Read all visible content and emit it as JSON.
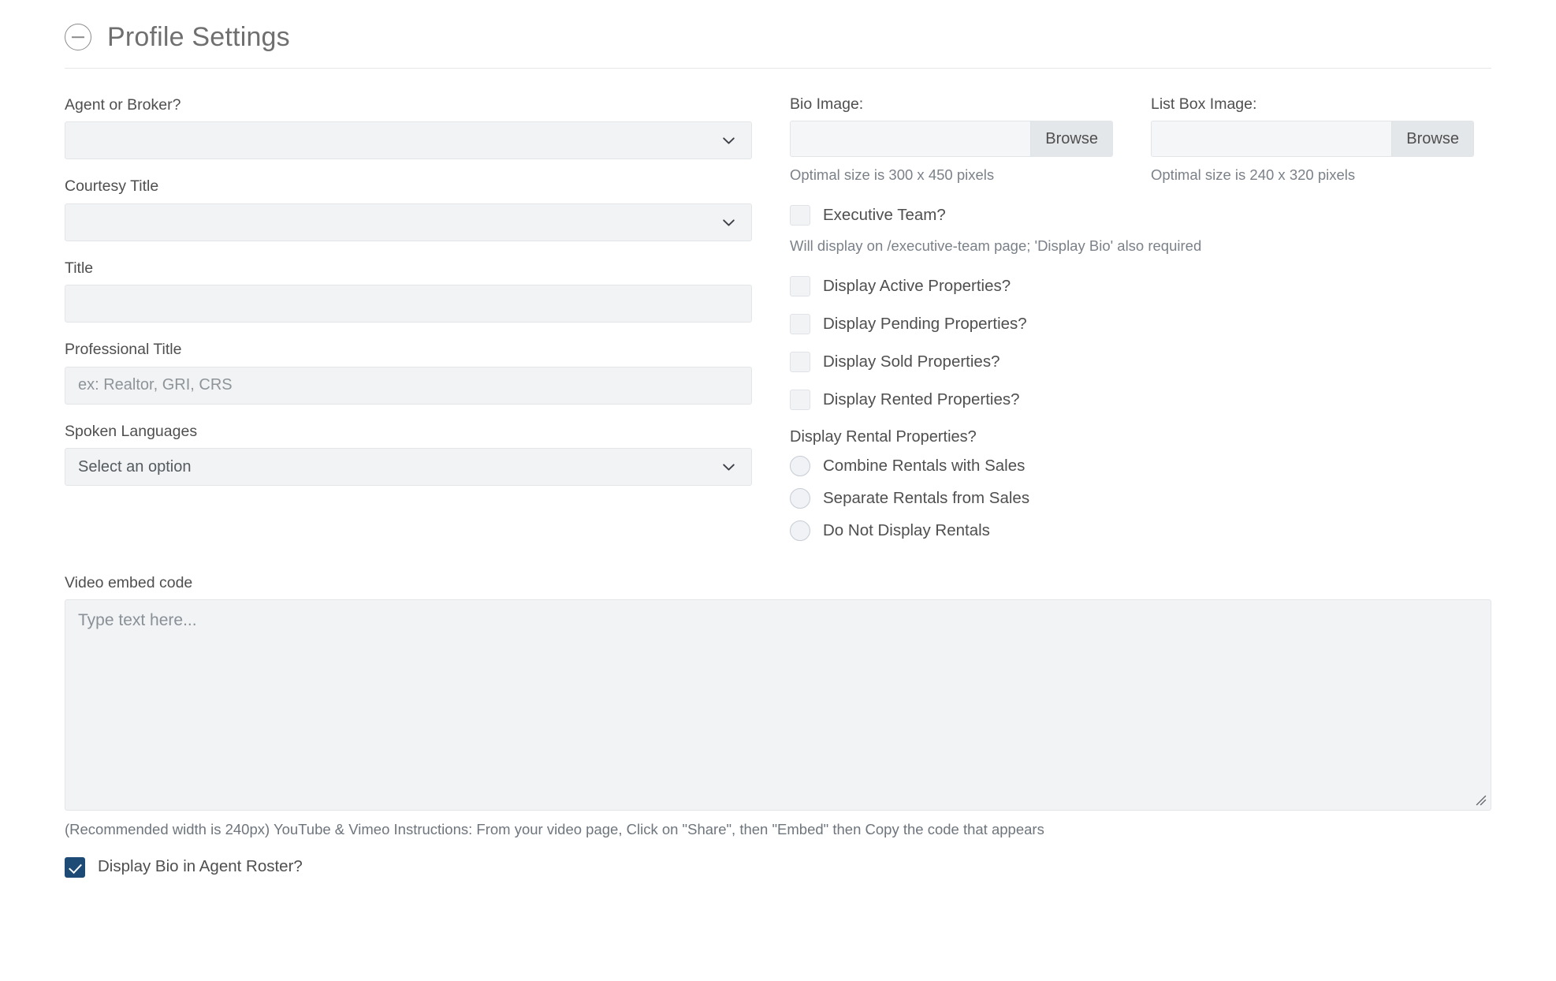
{
  "panel": {
    "title": "Profile Settings",
    "collapse_icon": "circle-minus-icon"
  },
  "left_column": {
    "agent_or_broker": {
      "label": "Agent or Broker?",
      "value": "",
      "chevron": "chevron-down-icon"
    },
    "courtesy_title": {
      "label": "Courtesy Title",
      "value": "",
      "chevron": "chevron-down-icon"
    },
    "title": {
      "label": "Title",
      "value": "",
      "placeholder": ""
    },
    "professional_title": {
      "label": "Professional Title",
      "value": "",
      "placeholder": "ex: Realtor, GRI, CRS"
    },
    "spoken_languages": {
      "label": "Spoken Languages",
      "value": "Select an option",
      "chevron": "chevron-down-icon"
    }
  },
  "right_column": {
    "bio_image": {
      "label": "Bio Image:",
      "value": "",
      "browse_label": "Browse",
      "hint": "Optimal size is 300 x 450 pixels"
    },
    "list_box_image": {
      "label": "List Box Image:",
      "value": "",
      "browse_label": "Browse",
      "hint": "Optimal size is 240 x 320 pixels"
    },
    "executive_team": {
      "label": "Executive Team?",
      "checked": false,
      "hint": "Will display on /executive-team page; 'Display Bio' also required"
    },
    "property_checkboxes": [
      {
        "label": "Display Active Properties?",
        "checked": false
      },
      {
        "label": "Display Pending Properties?",
        "checked": false
      },
      {
        "label": "Display Sold Properties?",
        "checked": false
      },
      {
        "label": "Display Rented Properties?",
        "checked": false
      }
    ],
    "rental_properties": {
      "label": "Display Rental Properties?",
      "options": [
        {
          "label": "Combine Rentals with Sales",
          "selected": false
        },
        {
          "label": "Separate Rentals from Sales",
          "selected": false
        },
        {
          "label": "Do Not Display Rentals",
          "selected": false
        }
      ]
    }
  },
  "video_embed": {
    "label": "Video embed code",
    "value": "",
    "placeholder": "Type text here...",
    "hint": "(Recommended width is 240px) YouTube & Vimeo Instructions: From your video page, Click on \"Share\", then \"Embed\" then Copy the code that appears",
    "resize_handle": "resize-handle-icon"
  },
  "display_bio": {
    "label": "Display Bio in Agent Roster?",
    "checked": true
  },
  "colors": {
    "accent": "#1d4b76",
    "field_bg": "#f1f3f5",
    "field_border": "#e3e6e9",
    "text": "#4f4f4f",
    "muted_text": "#7b8189",
    "divider": "#e6e6e6"
  }
}
